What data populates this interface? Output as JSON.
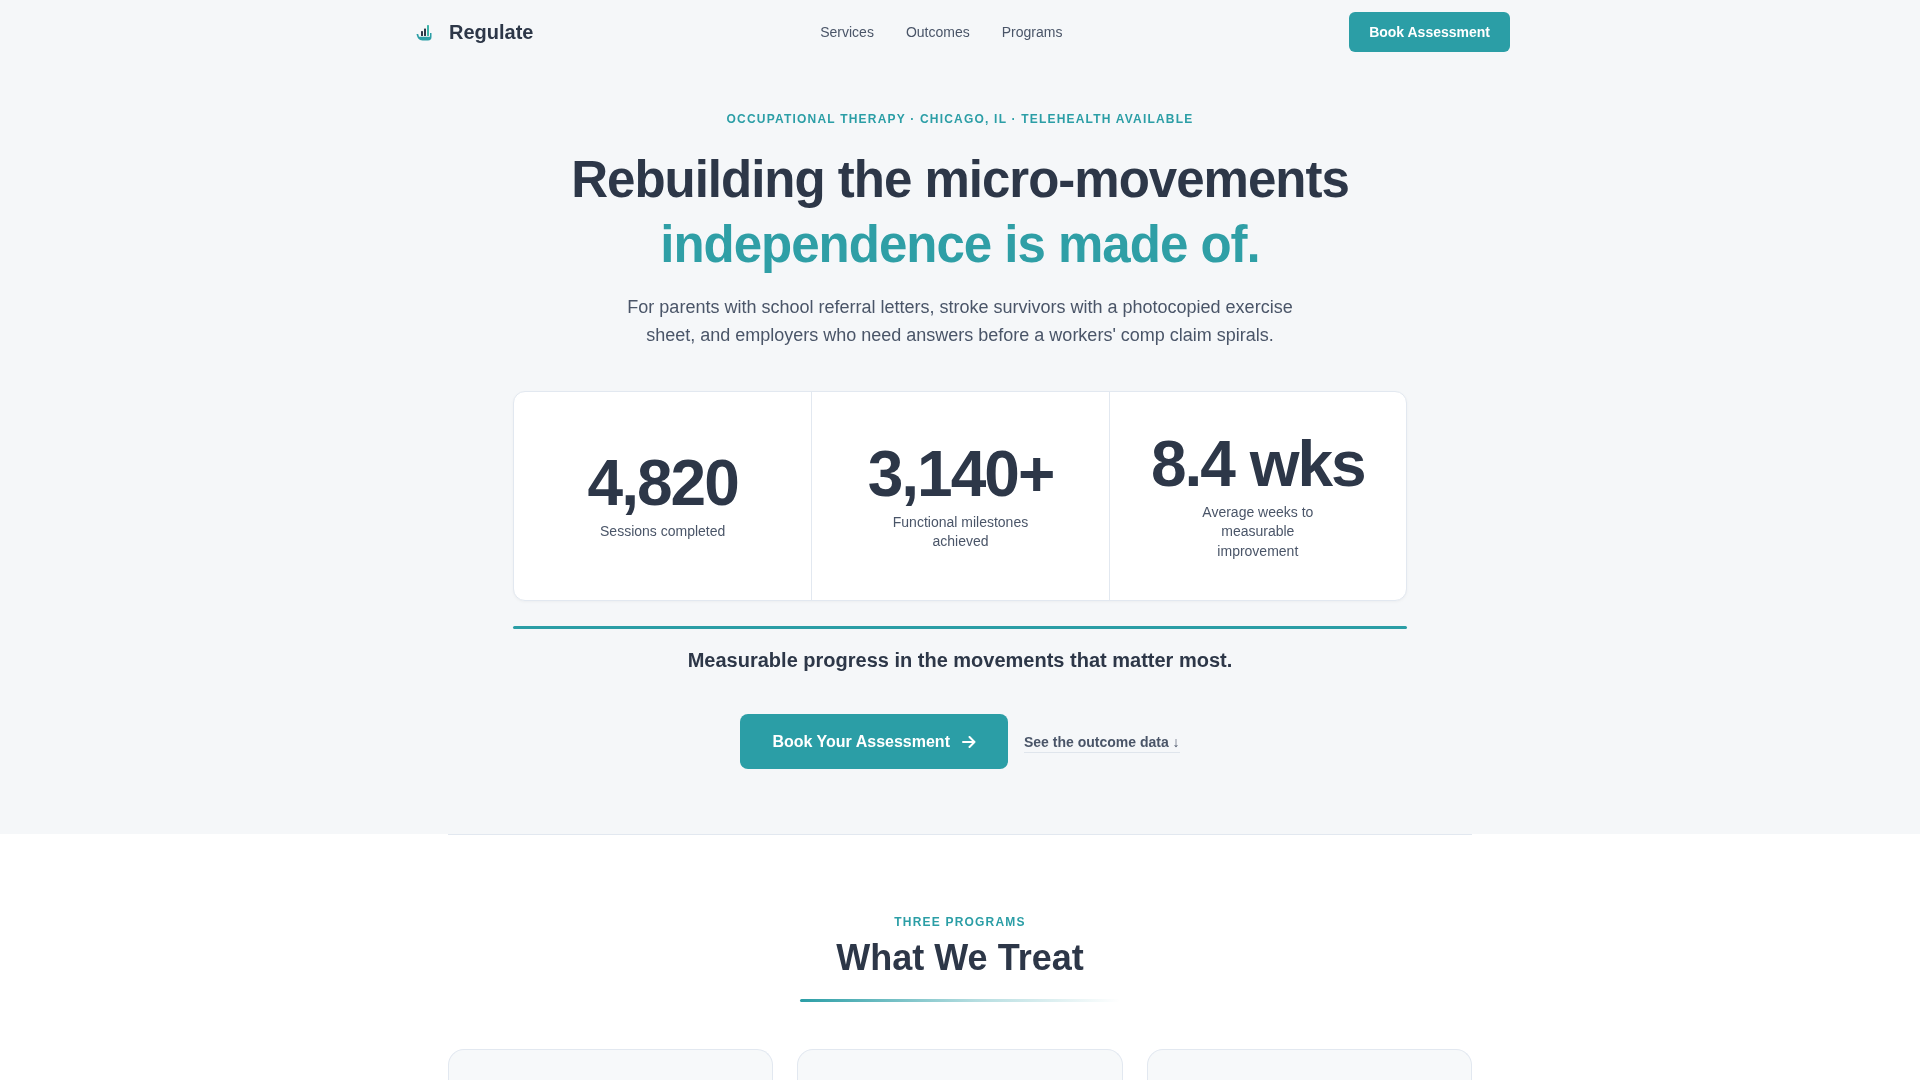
{
  "nav": {
    "brand": "Regulate",
    "links": [
      "Services",
      "Outcomes",
      "Programs"
    ],
    "button": "Book Assessment"
  },
  "hero": {
    "eyebrow": "OCCUPATIONAL THERAPY · CHICAGO, IL · TELEHEALTH AVAILABLE",
    "title": "Rebuilding the micro-movements",
    "title_highlight": "independence is made of.",
    "intro": "For parents with school referral letters, stroke survivors with a photocopied exercise sheet, and employers who need answers before a workers' comp claim spirals.",
    "stats": [
      {
        "value": "4,820",
        "label": "Sessions completed"
      },
      {
        "value": "3,140+",
        "label": "Functional milestones achieved"
      },
      {
        "value": "8.4 wks",
        "label": "Average weeks to measurable improvement"
      }
    ],
    "tagline": "Measurable progress in the movements that matter most.",
    "primary_button": "Book Your Assessment",
    "secondary_link": "See the outcome data ↓"
  },
  "programs": {
    "eyebrow": "THREE PROGRAMS",
    "title": "What We Treat"
  }
}
